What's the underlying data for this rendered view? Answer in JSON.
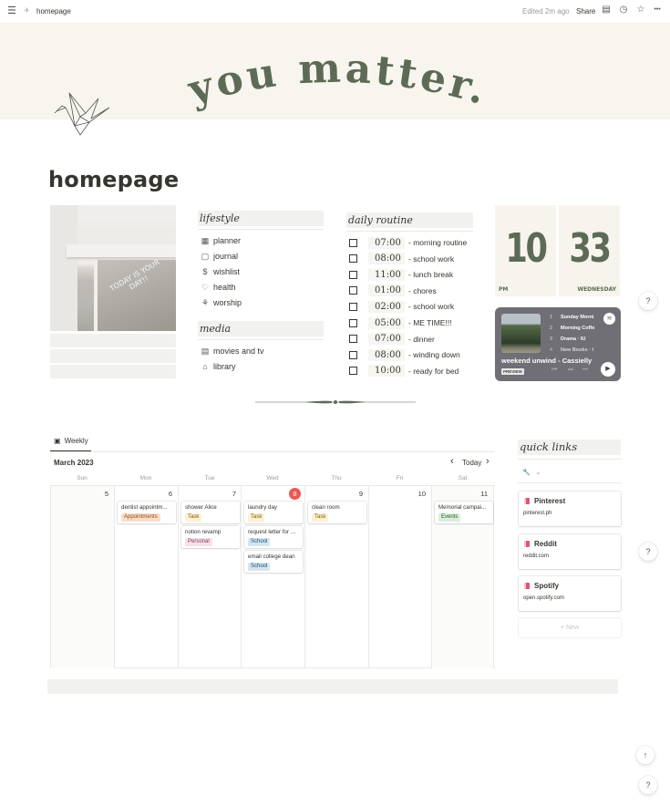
{
  "topbar": {
    "menu_icon": "☰",
    "breadcrumb": "homepage",
    "edited": "Edited 2m ago",
    "share": "Share",
    "icons": {
      "comments": "▤",
      "history": "◷",
      "favorite": "☆",
      "more": "•••"
    }
  },
  "cover": {
    "text": "you matter."
  },
  "page": {
    "title": "homepage"
  },
  "photo": {
    "caption": "TODAY IS YOUR DAY!!"
  },
  "lifestyle": {
    "heading": "lifestyle",
    "items": [
      {
        "icon": "▦",
        "label": "planner"
      },
      {
        "icon": "▢",
        "label": "journal"
      },
      {
        "icon": "$",
        "label": "wishlist"
      },
      {
        "icon": "♡",
        "label": "health"
      },
      {
        "icon": "⚘",
        "label": "worship"
      }
    ]
  },
  "media": {
    "heading": "media",
    "items": [
      {
        "icon": "▤",
        "label": "movies and tv"
      },
      {
        "icon": "⌂",
        "label": "library"
      }
    ]
  },
  "routine": {
    "heading": "daily routine",
    "items": [
      {
        "time": "07:00",
        "activity": "- morning routine"
      },
      {
        "time": "08:00",
        "activity": "- school work"
      },
      {
        "time": "11:00",
        "activity": "- lunch break"
      },
      {
        "time": "01:00",
        "activity": "- chores"
      },
      {
        "time": "02:00",
        "activity": "- school work"
      },
      {
        "time": "05:00",
        "activity": "- ME TIME!!!"
      },
      {
        "time": "07:00",
        "activity": "- dinner"
      },
      {
        "time": "08:00",
        "activity": "- winding down"
      },
      {
        "time": "10:00",
        "activity": "- ready for bed"
      }
    ]
  },
  "clock": {
    "hour": "10",
    "minute": "33",
    "ampm": "PM",
    "day": "WEDNESDAY"
  },
  "spotify": {
    "tracks": [
      {
        "n": "1",
        "title": "Sunday Morni"
      },
      {
        "n": "2",
        "title": "Morning Coffe"
      },
      {
        "n": "3",
        "title": "Drama · IU"
      },
      {
        "n": "4",
        "title": "New Books · I"
      }
    ],
    "playlist": "weekend unwind",
    "author": "- Cassielly",
    "preview": "PREVIEW",
    "prev": "⏮",
    "next": "⏭",
    "more": "•••",
    "play": "▶",
    "logo": "≋"
  },
  "calendar": {
    "view_tab": "Weekly",
    "view_icon": "▣",
    "month": "March 2023",
    "today_label": "Today",
    "prev": "‹",
    "next": "›",
    "weekdays": [
      "Sun",
      "Mon",
      "Tue",
      "Wed",
      "Thu",
      "Fri",
      "Sat"
    ],
    "days": [
      "5",
      "6",
      "7",
      "8",
      "9",
      "10",
      "11"
    ],
    "today_index": 3,
    "events": [
      {
        "day": 1,
        "slot": 0,
        "title": "dentist appointm...",
        "tag": "Appointments",
        "tag_bg": "#fadec9",
        "tag_fg": "#8a4a1e"
      },
      {
        "day": 2,
        "slot": 0,
        "title": "shower Alice",
        "tag": "Task",
        "tag_bg": "#fbf0d2",
        "tag_fg": "#7a5a12"
      },
      {
        "day": 2,
        "slot": 1,
        "title": "notion revamp",
        "tag": "Personal",
        "tag_bg": "#f5e0e9",
        "tag_fg": "#8a3a5a"
      },
      {
        "day": 3,
        "slot": 0,
        "title": "laundry day",
        "tag": "Task",
        "tag_bg": "#fbf0d2",
        "tag_fg": "#7a5a12"
      },
      {
        "day": 3,
        "slot": 1,
        "title": "request letter for ...",
        "tag": "School",
        "tag_bg": "#d3e5ef",
        "tag_fg": "#1f4f6e"
      },
      {
        "day": 3,
        "slot": 2,
        "title": "email college dean",
        "tag": "School",
        "tag_bg": "#d3e5ef",
        "tag_fg": "#1f4f6e"
      },
      {
        "day": 4,
        "slot": 0,
        "title": "clean room",
        "tag": "Task",
        "tag_bg": "#fbf0d2",
        "tag_fg": "#7a5a12"
      },
      {
        "day": 6,
        "slot": 0,
        "title": "Memorial campai...",
        "tag": "Events",
        "tag_bg": "#dbeddb",
        "tag_fg": "#2b5a2b"
      }
    ]
  },
  "quick_links": {
    "heading": "quick links",
    "filter_icon": "🔧",
    "filter_caret": "⌄",
    "links": [
      {
        "name": "Pinterest",
        "url": "pinterest.ph"
      },
      {
        "name": "Reddit",
        "url": "reddit.com"
      },
      {
        "name": "Spotify",
        "url": "open.spotify.com"
      }
    ],
    "new_label": "+ New"
  },
  "floating": {
    "help": "?",
    "scroll_top": "↑"
  },
  "colors": {
    "accent_green": "#5d6b56",
    "cover_bg": "#f7f5ee",
    "today_red": "#eb5757"
  }
}
